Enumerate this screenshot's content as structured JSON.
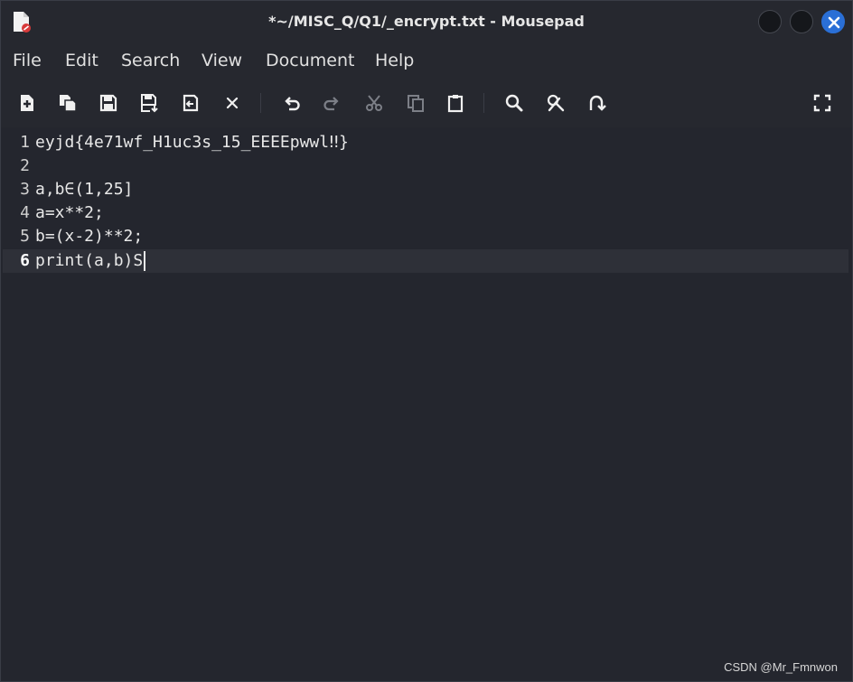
{
  "window": {
    "title": "*~/MISC_Q/Q1/_encrypt.txt - Mousepad"
  },
  "menu": [
    {
      "label": "File"
    },
    {
      "label": "Edit"
    },
    {
      "label": "Search"
    },
    {
      "label": "View"
    },
    {
      "label": "Document"
    },
    {
      "label": "Help"
    }
  ],
  "toolbar": {
    "icons": [
      "new-document-icon",
      "new-window-icon",
      "save-icon",
      "save-as-icon",
      "reload-icon",
      "close-tab-icon",
      "undo-icon",
      "redo-icon",
      "cut-icon",
      "copy-icon",
      "paste-icon",
      "find-icon",
      "find-replace-icon",
      "goto-line-icon",
      "fullscreen-icon"
    ]
  },
  "editor": {
    "lines": [
      {
        "num": "1",
        "text": "eyjd{4e71wf_H1uc3s_15_EEEEpwwl‼}"
      },
      {
        "num": "2",
        "text": ""
      },
      {
        "num": "3",
        "text": "a,b∈(1,25]"
      },
      {
        "num": "4",
        "text": "a=x**2;"
      },
      {
        "num": "5",
        "text": "b=(x-2)**2;"
      },
      {
        "num": "6",
        "text": "print(a,b)S"
      }
    ],
    "current_line": 6
  },
  "watermark": "CSDN @Mr_Fmnwon",
  "colors": {
    "background": "#24262e",
    "current_line": "#2e3038",
    "close_button": "#2a6fd6"
  }
}
